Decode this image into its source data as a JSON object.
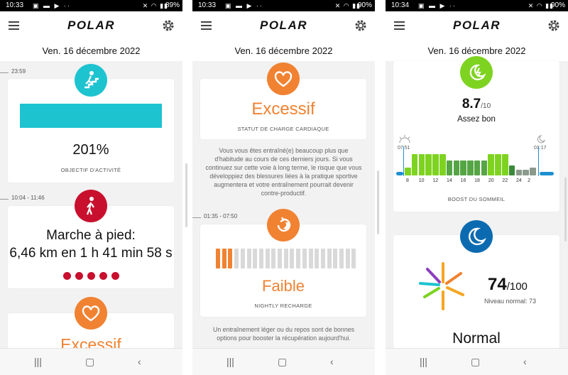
{
  "screens": [
    {
      "status": {
        "time": "10:33",
        "battery": "89%"
      },
      "app": {
        "logo": "POLAR"
      },
      "date": "Ven. 16 décembre 2022",
      "activity": {
        "time": "23:59",
        "percent": "201%",
        "caption": "OBJECTIF D'ACTIVITÉ",
        "progress_fraction": 1.0,
        "color": "#1ec3d0"
      },
      "session": {
        "time": "10:04 - 11:46",
        "title": "Marche à pied:",
        "detail": "6,46 km en 1 h 41 min 58 s",
        "dots": 5,
        "color": "#c8102e"
      },
      "cardio": {
        "label": "Excessif",
        "color": "#f08232"
      }
    },
    {
      "status": {
        "time": "10:33",
        "battery": "90%"
      },
      "app": {
        "logo": "POLAR"
      },
      "date": "Ven. 16 décembre 2022",
      "cardio": {
        "label": "Excessif",
        "caption": "STATUT DE CHARGE CARDIAQUE",
        "description": "Vous vous êtes entraîné(e) beaucoup plus que d'habitude au cours de ces derniers jours. Si vous continuez sur cette voie à long terme, le risque que vous développiez des blessures liées à la pratique sportive augmentera et votre entraînement pourrait devenir contre-productif."
      },
      "recharge": {
        "time": "01:35 - 07:50",
        "label": "Faible",
        "caption": "NIGHTLY RECHARGE",
        "filled_bars": 3,
        "total_bars": 23,
        "description": "Un entraînement léger ou du repos sont de bonnes options pour booster la récupération aujourd'hui."
      }
    },
    {
      "status": {
        "time": "10:34",
        "battery": "90%"
      },
      "app": {
        "logo": "POLAR"
      },
      "date": "Ven. 16 décembre 2022",
      "sleep": {
        "score": "8.7",
        "max": "/10",
        "rating": "Assez bon",
        "start": "07:51",
        "end": "01:17",
        "caption": "BOOST DU SOMMEIL",
        "ticks": [
          "8",
          "10",
          "12",
          "14",
          "16",
          "18",
          "20",
          "22",
          "24",
          "2"
        ],
        "levels": [
          0.35,
          1,
          1,
          1,
          1,
          1,
          0.7,
          0.7,
          0.7,
          0.7,
          0.7,
          0.7,
          1,
          1,
          1,
          0.45,
          0.25,
          0.25,
          0.35
        ]
      },
      "nightly": {
        "score": "74",
        "max": "/100",
        "normal_label": "Niveau normal: 73",
        "status": "Normal"
      }
    }
  ]
}
